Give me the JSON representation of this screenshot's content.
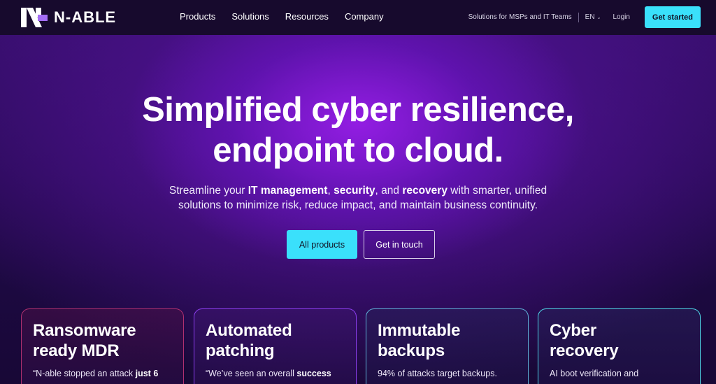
{
  "brand": {
    "name": "N-ABLE"
  },
  "nav": {
    "items": [
      "Products",
      "Solutions",
      "Resources",
      "Company"
    ],
    "msp_link": "Solutions for MSPs and IT Teams",
    "language": "EN",
    "login": "Login",
    "get_started": "Get started"
  },
  "hero": {
    "headline_line1": "Simplified cyber resilience,",
    "headline_line2": "endpoint to cloud.",
    "sub_part1": "Streamline your ",
    "sub_bold1": "IT management",
    "sub_part2": ", ",
    "sub_bold2": "security",
    "sub_part3": ", and ",
    "sub_bold3": "recovery",
    "sub_part4": " with smarter, unified",
    "sub_line2": "solutions to minimize risk, reduce impact, and maintain business continuity.",
    "cta_primary": "All products",
    "cta_secondary": "Get in touch"
  },
  "cards": [
    {
      "title_line1": "Ransomware",
      "title_line2": "ready MDR",
      "text": "“N-able stopped an attack ",
      "text_bold": "just 6"
    },
    {
      "title_line1": "Automated",
      "title_line2": "patching",
      "text": "“We’ve seen an overall ",
      "text_bold": "success"
    },
    {
      "title_line1": "Immutable",
      "title_line2": "backups",
      "text": "94% of attacks target backups.",
      "text_bold": ""
    },
    {
      "title_line1": "Cyber",
      "title_line2": "recovery",
      "text": "AI boot verification and",
      "text_bold": ""
    }
  ],
  "colors": {
    "accent": "#3ae0fb",
    "nav_bg": "#170a2d",
    "logo_purple": "#a46df5"
  }
}
